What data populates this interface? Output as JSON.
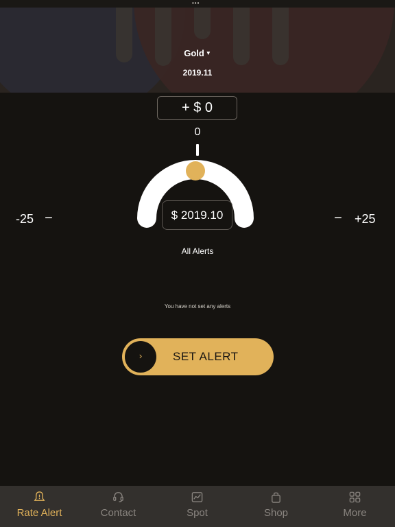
{
  "status_bar": {
    "left_text": "",
    "right_text": ""
  },
  "header": {
    "commodity": "Gold",
    "date": "2019.11"
  },
  "adjust": {
    "delta": "+ $ 0",
    "offset": "0",
    "price": "$ 2019.10",
    "minus_label": "-25",
    "minus_button": "−",
    "plus_button": "−",
    "plus_label": "+25"
  },
  "alerts": {
    "title": "All Alerts",
    "empty_message": "You have not set any alerts"
  },
  "set_alert": {
    "label": "SET ALERT",
    "chevron": "›"
  },
  "tabs": [
    {
      "label": "Rate Alert",
      "icon": "bell-icon",
      "active": true
    },
    {
      "label": "Contact",
      "icon": "headset-icon",
      "active": false
    },
    {
      "label": "Spot",
      "icon": "chart-icon",
      "active": false
    },
    {
      "label": "Shop",
      "icon": "bag-icon",
      "active": false
    },
    {
      "label": "More",
      "icon": "grid-icon",
      "active": false
    }
  ],
  "colors": {
    "accent": "#e1b25a",
    "background": "#151310",
    "tab_bar": "#33302d",
    "inactive_tab": "#8a8580"
  }
}
